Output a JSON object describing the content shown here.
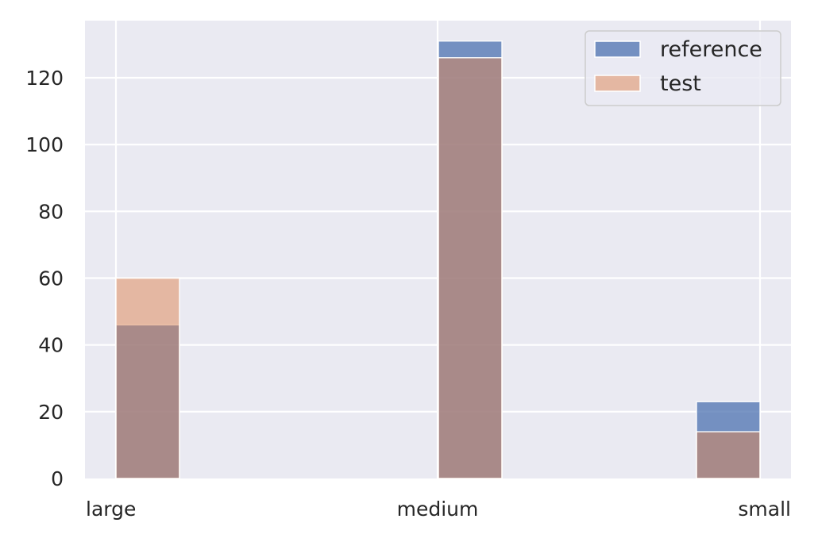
{
  "chart_data": {
    "type": "bar",
    "title": "",
    "xlabel": "",
    "ylabel": "",
    "categories": [
      "large",
      "medium",
      "small"
    ],
    "series": [
      {
        "name": "reference",
        "values": [
          46,
          131,
          23
        ],
        "color": "#4c72b0",
        "alpha": 0.75
      },
      {
        "name": "test",
        "values": [
          60,
          126,
          14
        ],
        "color": "#dd8452",
        "alpha": 0.5
      }
    ],
    "ylim": [
      0,
      137
    ],
    "yticks": [
      0,
      20,
      40,
      60,
      80,
      100,
      120
    ],
    "grid": true,
    "legend_position": "top-right",
    "background_color": "#eaeaf2",
    "grid_color": "#ffffff"
  }
}
